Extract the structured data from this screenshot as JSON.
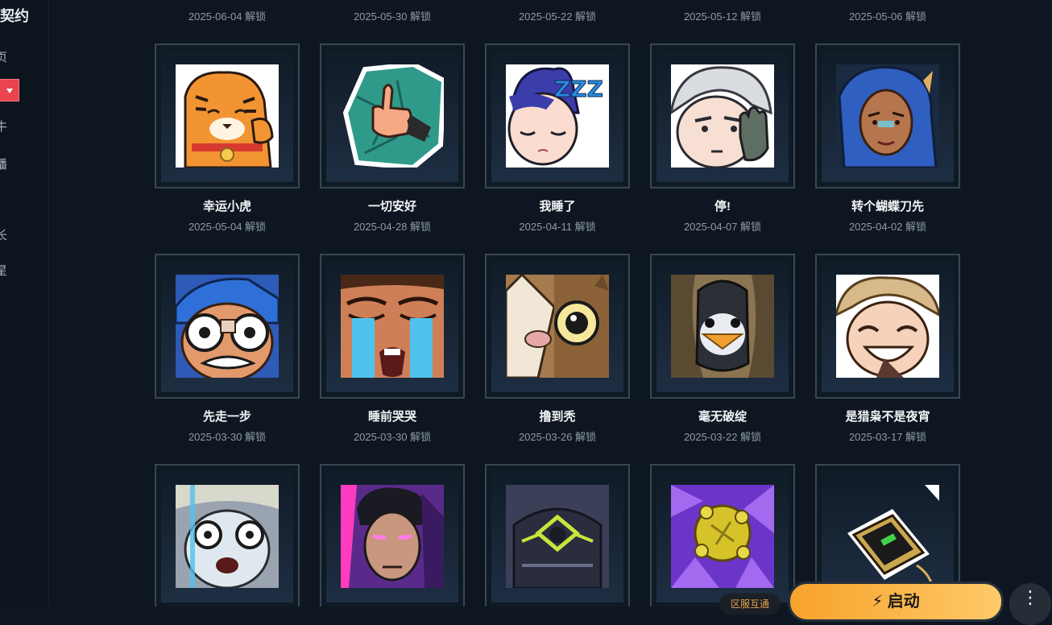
{
  "sidebar": {
    "title": "契约",
    "items": [
      "页",
      "",
      "牛",
      "播",
      "-",
      "长",
      "星"
    ]
  },
  "top_row_dates": [
    "2025-06-04 解锁",
    "2025-05-30 解锁",
    "2025-05-22 解锁",
    "2025-05-12 解锁",
    "2025-05-06 解锁"
  ],
  "rows": [
    [
      {
        "name": "幸运小虎",
        "date": "2025-05-04 解锁",
        "icon": "tiger-sticker-icon"
      },
      {
        "name": "一切安好",
        "date": "2025-04-28 解锁",
        "icon": "thumbs-up-sticker-icon"
      },
      {
        "name": "我睡了",
        "date": "2025-04-11 解锁",
        "icon": "sleeping-face-sticker-icon"
      },
      {
        "name": "停!",
        "date": "2025-04-07 解锁",
        "icon": "stop-hand-sticker-icon"
      },
      {
        "name": "转个蝴蝶刀先",
        "date": "2025-04-02 解锁",
        "icon": "blue-hair-agent-sticker-icon"
      }
    ],
    [
      {
        "name": "先走一步",
        "date": "2025-03-30 解锁",
        "icon": "scared-face-sticker-icon"
      },
      {
        "name": "睡前哭哭",
        "date": "2025-03-30 解锁",
        "icon": "crying-face-sticker-icon"
      },
      {
        "name": "撸到秃",
        "date": "2025-03-26 解锁",
        "icon": "owl-cat-sticker-icon"
      },
      {
        "name": "毫无破绽",
        "date": "2025-03-22 解锁",
        "icon": "penguin-sticker-icon"
      },
      {
        "name": "是猎枭不是夜宵",
        "date": "2025-03-17 解锁",
        "icon": "laughing-face-sticker-icon"
      }
    ],
    [
      {
        "name": "",
        "date": "",
        "icon": "shocked-face-sticker-icon"
      },
      {
        "name": "",
        "date": "",
        "icon": "neon-agent-sticker-icon"
      },
      {
        "name": "",
        "date": "",
        "icon": "robot-helmet-sticker-icon"
      },
      {
        "name": "",
        "date": "",
        "icon": "yellow-orb-sticker-icon"
      },
      {
        "name": "",
        "date": "",
        "icon": "power-bank-sticker-icon"
      }
    ]
  ],
  "footer": {
    "region_label": "区服互通",
    "launch_label": "启动",
    "more_label": "⋮"
  },
  "colors": {
    "background": "#0e1721",
    "accent": "#f7a32b",
    "red": "#e9444f"
  }
}
